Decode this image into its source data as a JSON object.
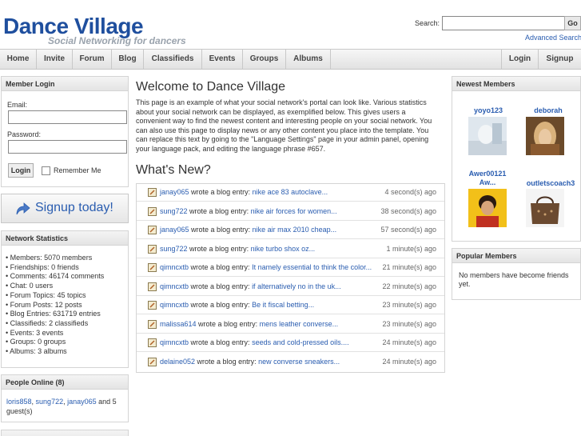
{
  "header": {
    "logo_main": "Dance Village",
    "logo_sub": "Social Networking for dancers",
    "search_label": "Search:",
    "search_value": "",
    "go_label": "Go",
    "advanced_search": "Advanced Search"
  },
  "nav": {
    "left": [
      "Home",
      "Invite",
      "Forum",
      "Blog",
      "Classifieds",
      "Events",
      "Groups",
      "Albums"
    ],
    "right": [
      "Login",
      "Signup"
    ]
  },
  "login": {
    "title": "Member Login",
    "email_label": "Email:",
    "email_value": "",
    "password_label": "Password:",
    "password_value": "",
    "login_button": "Login",
    "remember_label": "Remember Me"
  },
  "signup": {
    "label": "Signup today!"
  },
  "stats": {
    "title": "Network Statistics",
    "items": [
      "• Members: 5070 members",
      "• Friendships: 0 friends",
      "• Comments: 46174 comments",
      "• Chat: 0 users",
      "• Forum Topics: 45 topics",
      "• Forum Posts: 12 posts",
      "• Blog Entries: 631719 entries",
      "• Classifieds: 2 classifieds",
      "• Events: 3 events",
      "• Groups: 0 groups",
      "• Albums: 3 albums"
    ]
  },
  "online": {
    "title": "People Online (8)",
    "users": [
      "loris858",
      "sung722",
      "janay065"
    ],
    "suffix": " and 5 guest(s)"
  },
  "main": {
    "welcome_title": "Welcome to Dance Village",
    "intro": "This page is an example of what your social network's portal can look like. Various statistics about your social network can be displayed, as exemplified below. This gives users a convenient way to find the newest content and interesting people on your social network. You can also use this page to display news or any other content you place into the template. You can replace this text by going to the \"Language Settings\" page in your admin panel, opening your language pack, and editing the language phrase #657.",
    "whats_new_title": "What's New?",
    "feed": [
      {
        "user": "janay065",
        "action": " wrote a blog entry: ",
        "entry": "nike ace 83 autoclave...",
        "time": "4 second(s) ago"
      },
      {
        "user": "sung722",
        "action": " wrote a blog entry: ",
        "entry": "nike air forces for women...",
        "time": "38 second(s) ago"
      },
      {
        "user": "janay065",
        "action": " wrote a blog entry: ",
        "entry": "nike air max 2010 cheap...",
        "time": "57 second(s) ago"
      },
      {
        "user": "sung722",
        "action": " wrote a blog entry: ",
        "entry": "nike turbo shox oz...",
        "time": "1 minute(s) ago"
      },
      {
        "user": "qimncxtb",
        "action": " wrote a blog entry: ",
        "entry": "It namely essential to think the color...",
        "time": "21 minute(s) ago"
      },
      {
        "user": "qimncxtb",
        "action": " wrote a blog entry: ",
        "entry": "if alternatively no in the uk...",
        "time": "22 minute(s) ago"
      },
      {
        "user": "qimncxtb",
        "action": " wrote a blog entry: ",
        "entry": "Be it fiscal betting...",
        "time": "23 minute(s) ago"
      },
      {
        "user": "malissa614",
        "action": " wrote a blog entry: ",
        "entry": "mens leather converse...",
        "time": "23 minute(s) ago"
      },
      {
        "user": "qimncxtb",
        "action": " wrote a blog entry: ",
        "entry": "seeds and cold-pressed oils....",
        "time": "24 minute(s) ago"
      },
      {
        "user": "delaine052",
        "action": " wrote a blog entry: ",
        "entry": "new converse sneakers...",
        "time": "24 minute(s) ago"
      }
    ]
  },
  "newest": {
    "title": "Newest Members",
    "members": [
      "yoyo123",
      "deborah",
      "Awer00121 Aw...",
      "outletscoach3"
    ]
  },
  "popular": {
    "title": "Popular Members",
    "empty_text": "No members have become friends yet."
  },
  "colors": {
    "brand": "#1f4f9e",
    "link": "#2a5db0",
    "subtitle": "#9aa3ad"
  }
}
